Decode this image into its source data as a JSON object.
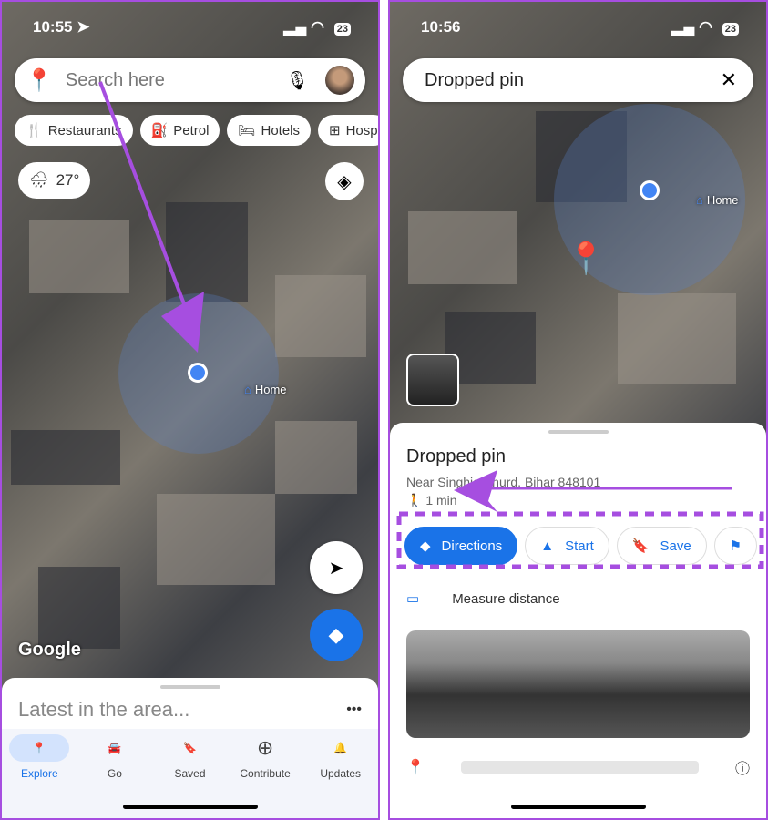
{
  "left": {
    "status": {
      "time": "10:55",
      "battery": "23"
    },
    "search": {
      "placeholder": "Search here"
    },
    "chips": [
      "Restaurants",
      "Petrol",
      "Hotels",
      "Hosp"
    ],
    "weather": "27°",
    "home_label": "Home",
    "google_logo": "Google",
    "sheet_title": "Latest in the area...",
    "nav": [
      {
        "label": "Explore",
        "icon": "pin-icon",
        "active": true
      },
      {
        "label": "Go",
        "icon": "car-icon"
      },
      {
        "label": "Saved",
        "icon": "bookmark-icon"
      },
      {
        "label": "Contribute",
        "icon": "plus-circle-icon"
      },
      {
        "label": "Updates",
        "icon": "bell-icon"
      }
    ]
  },
  "right": {
    "status": {
      "time": "10:56",
      "battery": "23"
    },
    "search": {
      "value": "Dropped pin"
    },
    "home_label": "Home",
    "place": {
      "title": "Dropped pin",
      "address": "Near Singhia Khurd, Bihar 848101",
      "walk": "1 min"
    },
    "actions": [
      "Directions",
      "Start",
      "Save"
    ],
    "measure": "Measure distance"
  },
  "colors": {
    "accent": "#1a73e8",
    "annotation": "#a64ee0"
  }
}
